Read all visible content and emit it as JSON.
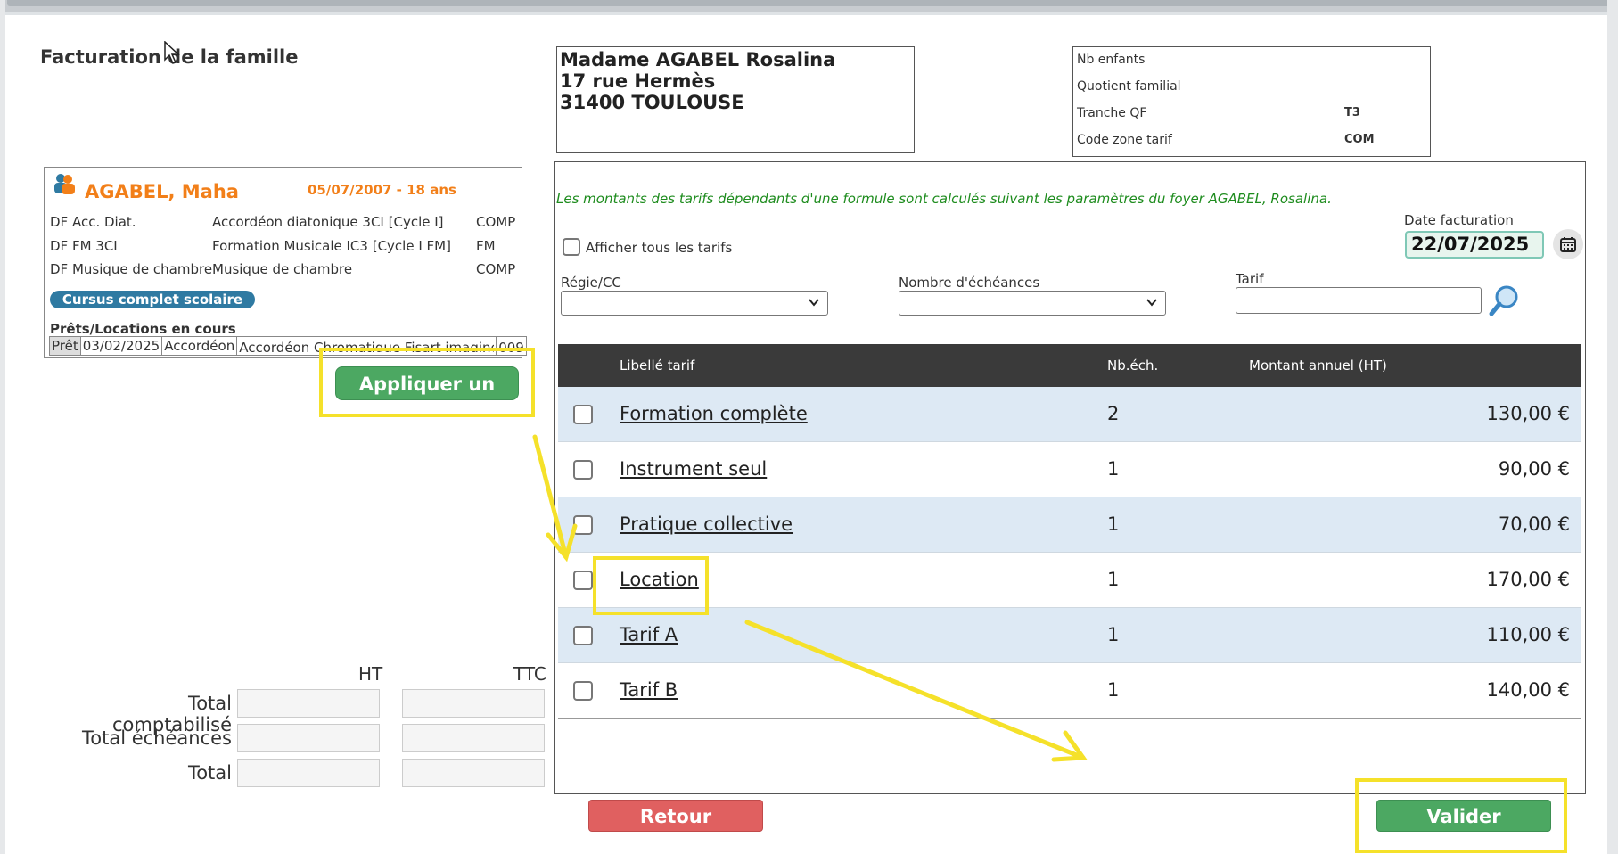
{
  "page": {
    "title": "Facturation de la famille"
  },
  "address": {
    "line1": "Madame AGABEL Rosalina",
    "line2": "17 rue Hermès",
    "line3": "31400 TOULOUSE"
  },
  "family_info": [
    {
      "label": "Nb enfants",
      "value": ""
    },
    {
      "label": "Quotient familial",
      "value": ""
    },
    {
      "label": "Tranche QF",
      "value": "T3"
    },
    {
      "label": "Code zone tarif",
      "value": "COM"
    }
  ],
  "student": {
    "name": "AGABEL, Maha",
    "birth": "05/07/2007 - 18 ans",
    "courses": [
      {
        "code": "DF Acc. Diat.",
        "label": "Accordéon diatonique 3CI [Cycle I]",
        "type": "COMP"
      },
      {
        "code": "DF FM 3CI",
        "label": "Formation Musicale IC3 [Cycle I FM]",
        "type": "FM"
      },
      {
        "code": "DF Musique de chambre",
        "label": "Musique de chambre",
        "type": "COMP"
      }
    ],
    "cursus_badge": "Cursus complet scolaire",
    "loans_title": "Prêts/Locations en cours",
    "loans": [
      {
        "kind": "Prêt",
        "date": "03/02/2025",
        "instrument": "Accordéon",
        "desc": "Accordéon Chromatique Fisart imagine",
        "num": "009"
      }
    ]
  },
  "apply_button": "Appliquer un tarif",
  "totals": {
    "ht_header": "HT",
    "ttc_header": "TTC",
    "rows": [
      {
        "label": "Total comptabilisé"
      },
      {
        "label": "Total échéances"
      },
      {
        "label": "Total"
      }
    ]
  },
  "notice": "Les montants des tarifs dépendants d'une formule sont calculés suivant les paramètres du foyer AGABEL, Rosalina.",
  "filters": {
    "show_all_label": "Afficher tous les tarifs",
    "regie_label": "Régie/CC",
    "echeances_label": "Nombre d'échéances",
    "tarif_label": "Tarif",
    "date_label": "Date facturation",
    "date_value": "22/07/2025"
  },
  "table": {
    "headers": {
      "libelle": "Libellé tarif",
      "nb": "Nb.éch.",
      "montant": "Montant annuel (HT)"
    },
    "rows": [
      {
        "libelle": "Formation complète",
        "nb": "2",
        "montant": "130,00 €"
      },
      {
        "libelle": "Instrument seul",
        "nb": "1",
        "montant": "90,00 €"
      },
      {
        "libelle": "Pratique collective",
        "nb": "1",
        "montant": "70,00 €"
      },
      {
        "libelle": "Location",
        "nb": "1",
        "montant": "170,00 €"
      },
      {
        "libelle": "Tarif A",
        "nb": "1",
        "montant": "110,00 €"
      },
      {
        "libelle": "Tarif B",
        "nb": "1",
        "montant": "140,00 €"
      }
    ]
  },
  "buttons": {
    "retour": "Retour",
    "valider": "Valider"
  },
  "colors": {
    "accent_orange": "#f27f19",
    "green": "#4ca862",
    "red": "#e06060",
    "highlight": "#f5e12a",
    "row_alt": "#dde9f4"
  }
}
